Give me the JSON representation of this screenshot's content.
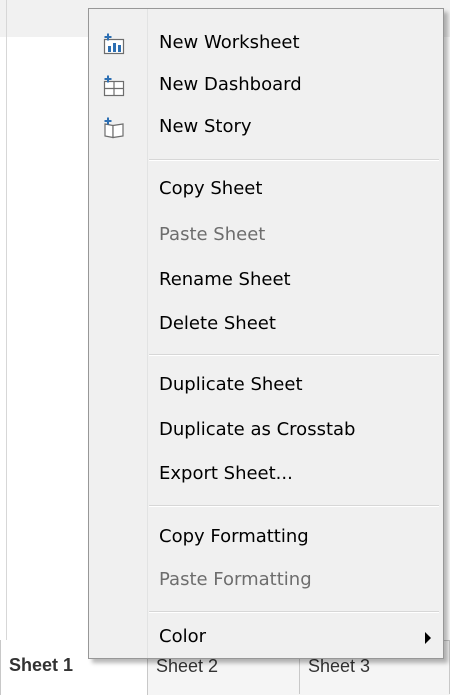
{
  "sheet_tabs": [
    {
      "label": "Sheet 1",
      "active": true
    },
    {
      "label": "Sheet 2",
      "active": false
    },
    {
      "label": "Sheet 3",
      "active": false
    }
  ],
  "context_menu": {
    "groups": [
      [
        {
          "label": "New Worksheet",
          "icon": "new-worksheet-icon",
          "enabled": true
        },
        {
          "label": "New Dashboard",
          "icon": "new-dashboard-icon",
          "enabled": true
        },
        {
          "label": "New Story",
          "icon": "new-story-icon",
          "enabled": true
        }
      ],
      [
        {
          "label": "Copy Sheet",
          "enabled": true
        },
        {
          "label": "Paste Sheet",
          "enabled": false
        },
        {
          "label": "Rename Sheet",
          "enabled": true
        },
        {
          "label": "Delete Sheet",
          "enabled": true
        }
      ],
      [
        {
          "label": "Duplicate Sheet",
          "enabled": true
        },
        {
          "label": "Duplicate as Crosstab",
          "enabled": true
        },
        {
          "label": "Export Sheet...",
          "enabled": true
        }
      ],
      [
        {
          "label": "Copy Formatting",
          "enabled": true
        },
        {
          "label": "Paste Formatting",
          "enabled": false
        }
      ],
      [
        {
          "label": "Color",
          "enabled": true,
          "submenu": true
        }
      ]
    ]
  },
  "colors": {
    "icon_blue": "#2d6fb3",
    "icon_gray": "#6d6d6d",
    "disabled_text": "#6d6d6d"
  }
}
